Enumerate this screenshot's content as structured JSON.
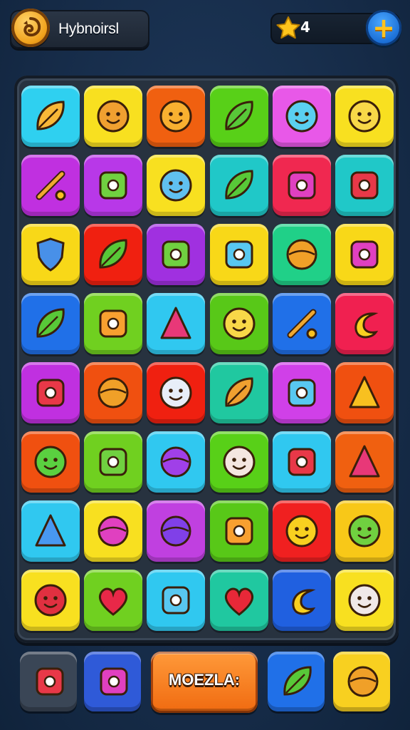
{
  "header": {
    "player_name": "Hybnoirsl",
    "star_count": "4",
    "avatar_icon": "swirl-emblem-icon",
    "star_icon": "star-icon",
    "add_icon": "plus-icon"
  },
  "board": {
    "rows": 8,
    "cols": 6,
    "tiles": [
      [
        {
          "color": "#2fd0f0",
          "icon": "maple-leaf-icon"
        },
        {
          "color": "#f8e020",
          "icon": "bear-face-icon"
        },
        {
          "color": "#f06010",
          "icon": "smiling-blob-icon"
        },
        {
          "color": "#58d018",
          "icon": "heart-leaf-icon"
        },
        {
          "color": "#e858e8",
          "icon": "cloud-face-icon"
        },
        {
          "color": "#f8e020",
          "icon": "smiley-face-icon"
        }
      ],
      [
        {
          "color": "#c030e0",
          "icon": "crossed-tools-icon"
        },
        {
          "color": "#b838e8",
          "icon": "basket-icon"
        },
        {
          "color": "#f8e020",
          "icon": "vase-face-icon"
        },
        {
          "color": "#20c8c8",
          "icon": "leaf-icon"
        },
        {
          "color": "#f02850",
          "icon": "map-pin-icon"
        },
        {
          "color": "#20c8c8",
          "icon": "strawberry-icon"
        }
      ],
      [
        {
          "color": "#f8d818",
          "icon": "shield-icon"
        },
        {
          "color": "#f02010",
          "icon": "leaf-bubble-icon"
        },
        {
          "color": "#a030e0",
          "icon": "orange-fruit-icon"
        },
        {
          "color": "#f8d818",
          "icon": "robot-box-icon"
        },
        {
          "color": "#20d088",
          "icon": "chat-bubble-icon"
        },
        {
          "color": "#f8d818",
          "icon": "toy-car-icon"
        }
      ],
      [
        {
          "color": "#2070e8",
          "icon": "plant-icon"
        },
        {
          "color": "#70d020",
          "icon": "treasure-chest-icon"
        },
        {
          "color": "#30c8f0",
          "icon": "arrow-up-icon"
        },
        {
          "color": "#58c818",
          "icon": "smiley-face-icon"
        },
        {
          "color": "#2070e8",
          "icon": "wrench-icon"
        },
        {
          "color": "#f02050",
          "icon": "banana-icon"
        }
      ],
      [
        {
          "color": "#c030e0",
          "icon": "book-icon"
        },
        {
          "color": "#f05010",
          "icon": "globe-icon"
        },
        {
          "color": "#f02010",
          "icon": "ghost-icon"
        },
        {
          "color": "#20c8a0",
          "icon": "feather-icon"
        },
        {
          "color": "#d040e8",
          "icon": "paper-bag-icon"
        },
        {
          "color": "#f05010",
          "icon": "party-hat-icon"
        }
      ],
      [
        {
          "color": "#f05010",
          "icon": "green-blob-icon"
        },
        {
          "color": "#70d020",
          "icon": "cannon-icon"
        },
        {
          "color": "#30c8f0",
          "icon": "bubble-icon"
        },
        {
          "color": "#58d018",
          "icon": "doll-face-icon"
        },
        {
          "color": "#30c8f0",
          "icon": "hand-truck-icon"
        },
        {
          "color": "#f06010",
          "icon": "arrow-icon"
        }
      ],
      [
        {
          "color": "#30c8f0",
          "icon": "crayon-icon"
        },
        {
          "color": "#f8e020",
          "icon": "gear-ring-icon"
        },
        {
          "color": "#c040e0",
          "icon": "planet-icon"
        },
        {
          "color": "#58c818",
          "icon": "football-icon"
        },
        {
          "color": "#f02020",
          "icon": "yellow-face-icon"
        },
        {
          "color": "#f8c818",
          "icon": "green-face-icon"
        }
      ],
      [
        {
          "color": "#f8e020",
          "icon": "red-spiky-icon"
        },
        {
          "color": "#70d020",
          "icon": "heart-icon"
        },
        {
          "color": "#30c8f0",
          "icon": "jar-icon"
        },
        {
          "color": "#20c8a0",
          "icon": "red-drop-icon"
        },
        {
          "color": "#2060e0",
          "icon": "letter-c-icon"
        },
        {
          "color": "#f8e020",
          "icon": "white-face-icon"
        }
      ]
    ]
  },
  "footer": {
    "main_label": "MOEZLA:",
    "buttons": [
      {
        "color": "#3a4656",
        "icon": "goat-icon"
      },
      {
        "color": "#2f5ad8",
        "icon": "dolphin-icon"
      },
      {
        "color": "#2070e8",
        "icon": "green-leaf-icon"
      },
      {
        "color": "#f8d020",
        "icon": "globe-bird-icon"
      }
    ]
  }
}
